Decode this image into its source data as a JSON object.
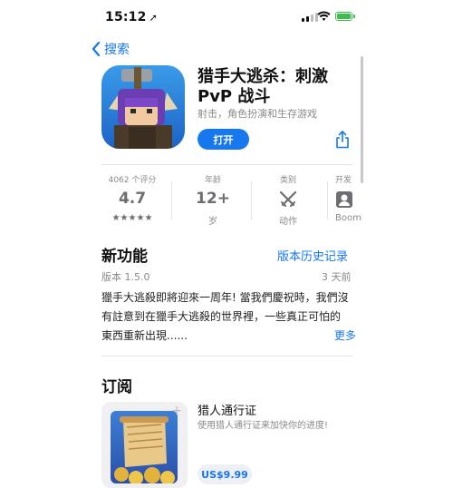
{
  "status_bar": {
    "time": "15:12",
    "location_arrow": "➚"
  },
  "nav": {
    "back_label": "搜索"
  },
  "app": {
    "title": "猎手大逃杀：刺激PvP 战斗",
    "subtitle": "射击，角色扮演和生存游戏",
    "open_label": "打开"
  },
  "stats": [
    {
      "label": "4062 个评分",
      "value": "4.7",
      "detail": "★★★★★"
    },
    {
      "label": "年龄",
      "value": "12+",
      "detail": "岁"
    },
    {
      "label": "类别",
      "value": "",
      "detail": "动作",
      "icon": "swords-icon"
    },
    {
      "label": "开发",
      "value": "",
      "detail": "BoomB",
      "icon": "developer-icon"
    }
  ],
  "whats_new": {
    "heading": "新功能",
    "history_link": "版本历史记录",
    "version": "版本 1.5.0",
    "date": "3 天前",
    "text": "獵手大逃殺即將迎來一周年! 當我們慶祝時，我們沒有註意到在獵手大逃殺的世界裡，一些真正可怕的東西重新出現......",
    "more_label": "更多"
  },
  "subscription": {
    "heading": "订阅",
    "title": "猎人通行证",
    "description": "使用猎人通行证来加快你的进度!",
    "price": "US$9.99"
  },
  "colors": {
    "accent": "#1677ee",
    "battery": "#3cbf4a",
    "secondary_text": "#8a8a8e"
  }
}
